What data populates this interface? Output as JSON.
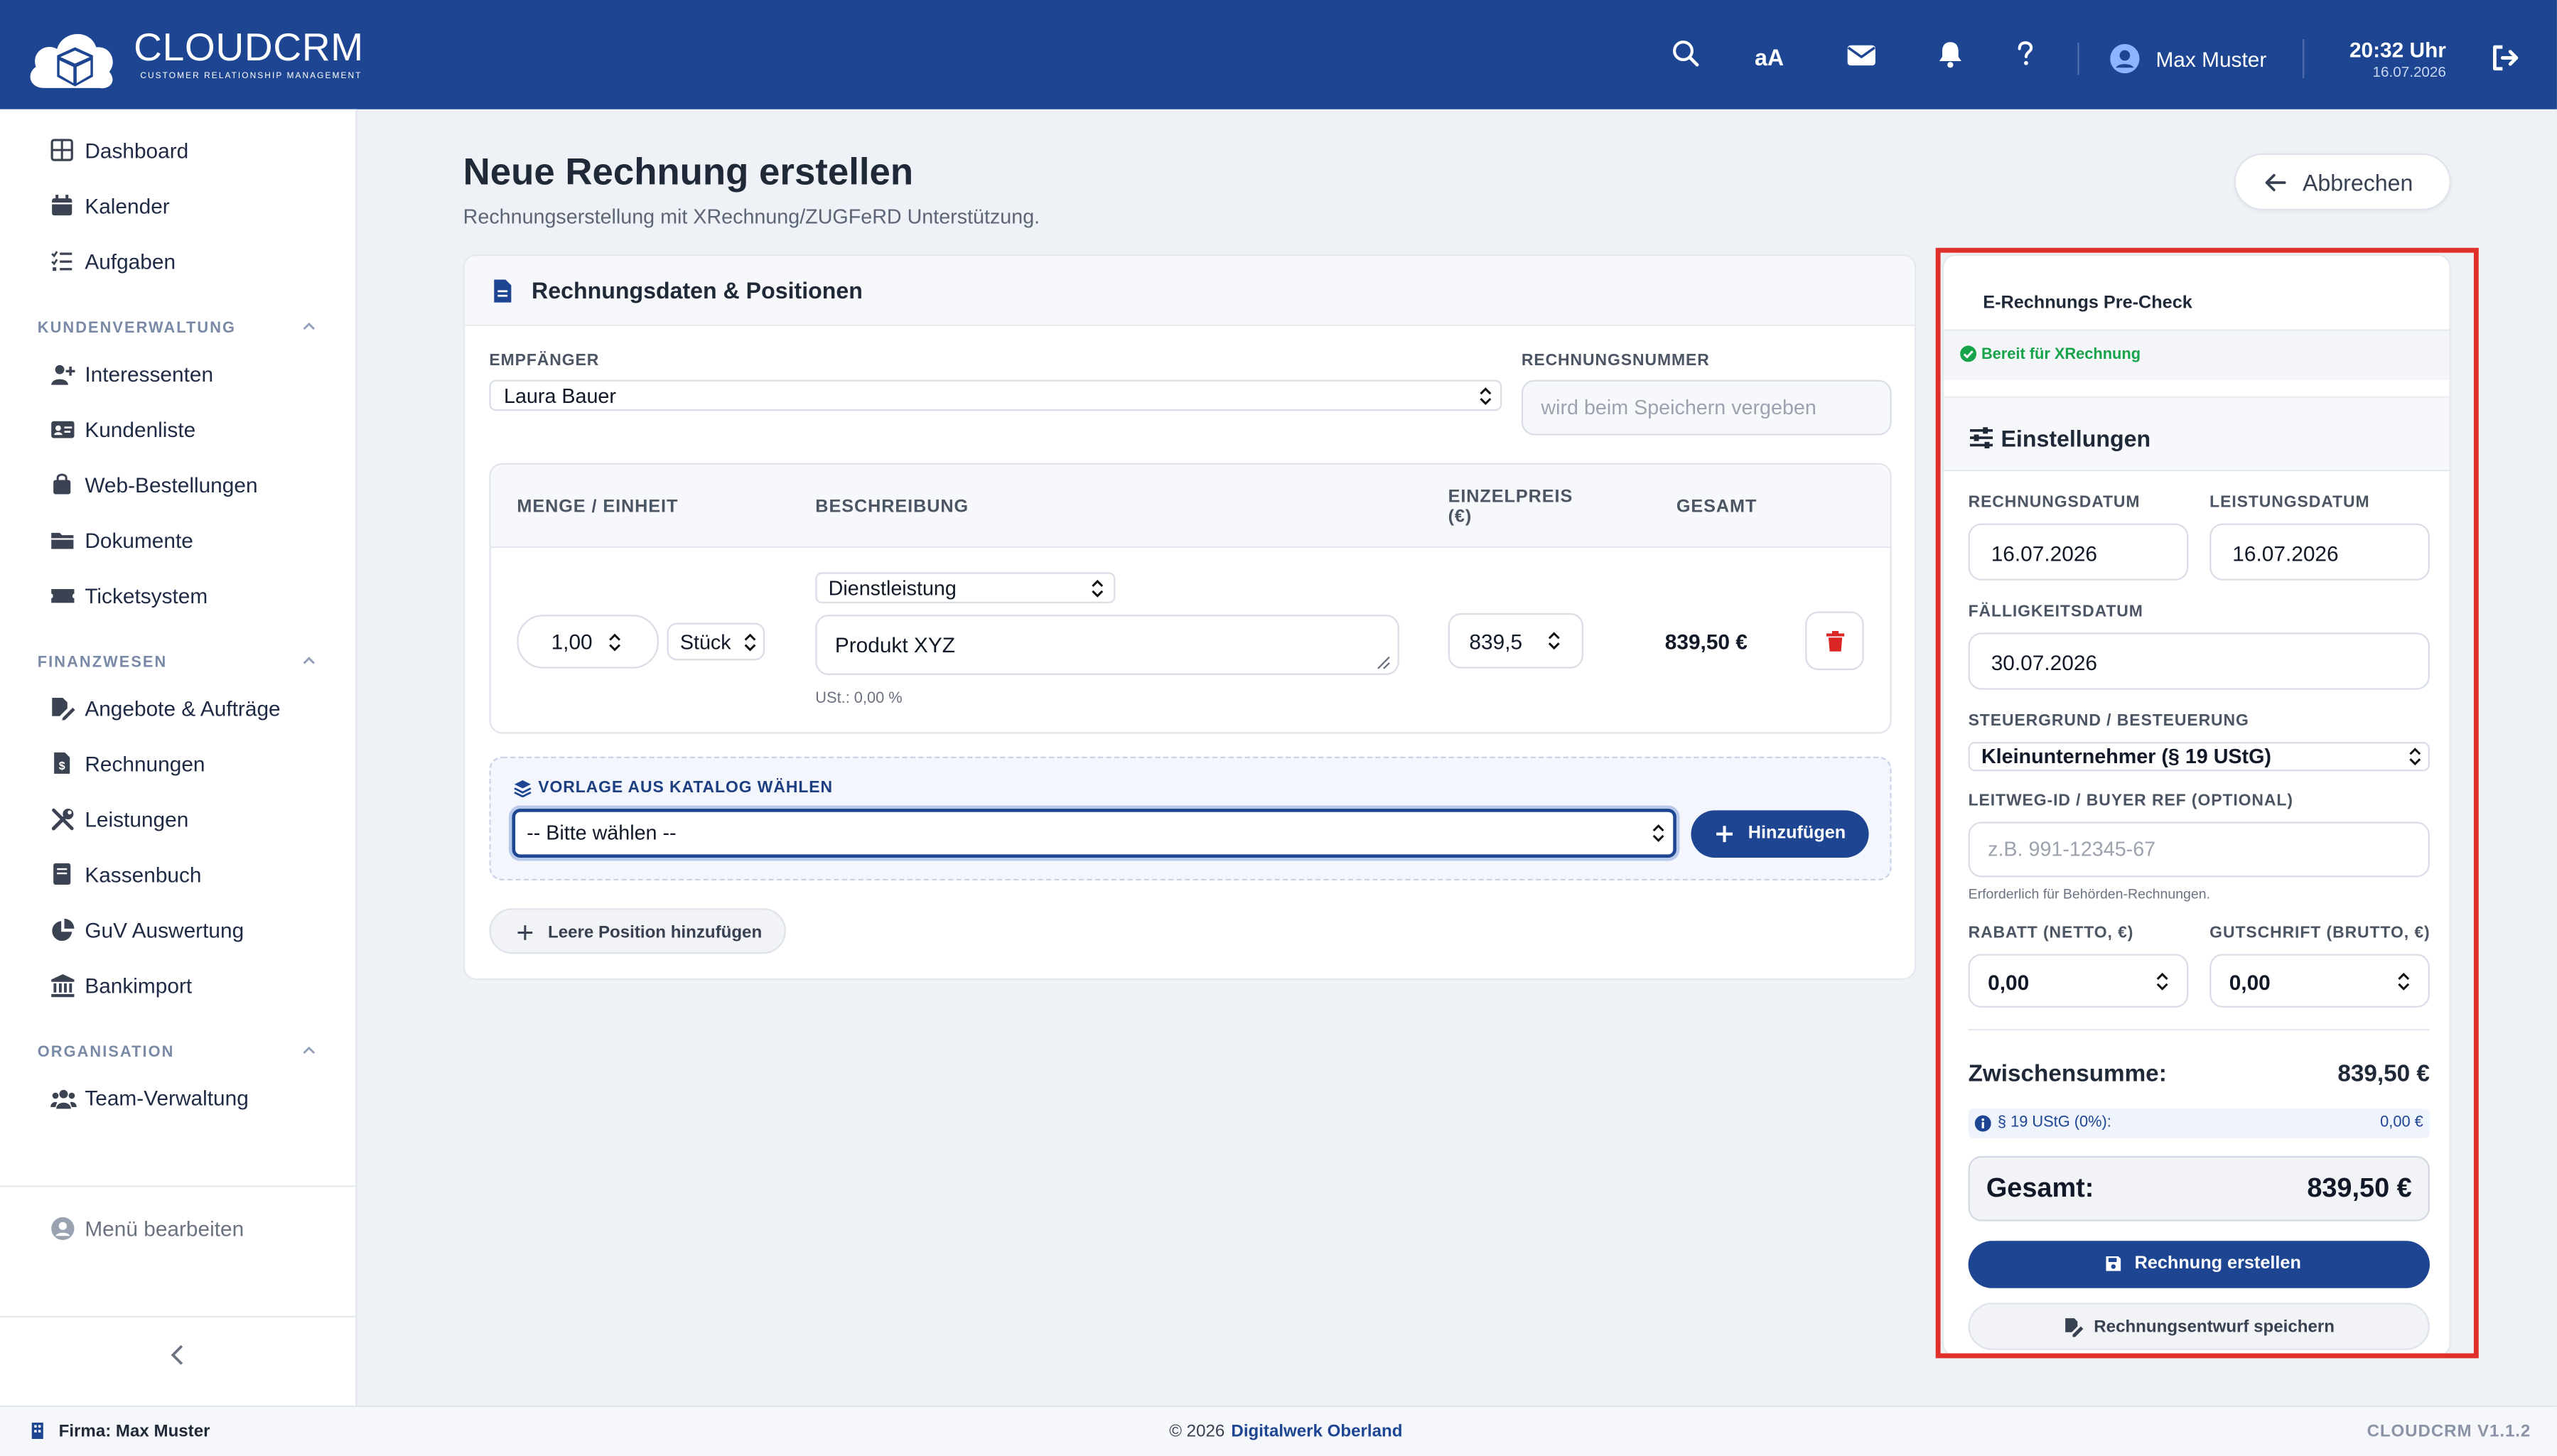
{
  "app": {
    "logo_name": "CLOUDCRM",
    "logo_sub": "CUSTOMER RELATIONSHIP MANAGEMENT",
    "brand_color": "#1d4592"
  },
  "header": {
    "text_size_label": "aA",
    "user_name": "Max Muster",
    "time": "20:32 Uhr",
    "date": "16.07.2026"
  },
  "sidebar": {
    "top_items": [
      {
        "label": "Dashboard",
        "icon": "grid-icon"
      },
      {
        "label": "Kalender",
        "icon": "calendar-icon"
      },
      {
        "label": "Aufgaben",
        "icon": "list-check-icon"
      }
    ],
    "sections": [
      {
        "title": "KUNDENVERWALTUNG",
        "items": [
          {
            "label": "Interessenten",
            "icon": "user-plus-icon"
          },
          {
            "label": "Kundenliste",
            "icon": "id-card-icon"
          },
          {
            "label": "Web-Bestellungen",
            "icon": "shopping-bag-icon"
          },
          {
            "label": "Dokumente",
            "icon": "folder-icon"
          },
          {
            "label": "Ticketsystem",
            "icon": "ticket-icon"
          }
        ]
      },
      {
        "title": "FINANZWESEN",
        "items": [
          {
            "label": "Angebote & Aufträge",
            "icon": "file-signature-icon"
          },
          {
            "label": "Rechnungen",
            "icon": "invoice-icon"
          },
          {
            "label": "Leistungen",
            "icon": "tools-icon"
          },
          {
            "label": "Kassenbuch",
            "icon": "book-icon"
          },
          {
            "label": "GuV Auswertung",
            "icon": "pie-chart-icon"
          },
          {
            "label": "Bankimport",
            "icon": "bank-icon"
          }
        ]
      },
      {
        "title": "ORGANISATION",
        "items": [
          {
            "label": "Team-Verwaltung",
            "icon": "users-icon"
          }
        ]
      }
    ],
    "edit_menu_label": "Menü bearbeiten"
  },
  "page": {
    "title": "Neue Rechnung erstellen",
    "subtitle": "Rechnungserstellung mit XRechnung/ZUGFeRD Unterstützung.",
    "cancel_label": "Abbrechen"
  },
  "invoice": {
    "card_title": "Rechnungsdaten & Positionen",
    "recipient_label": "EMPFÄNGER",
    "recipient_value": "Laura Bauer",
    "number_label": "RECHNUNGSNUMMER",
    "number_placeholder": "wird beim Speichern vergeben",
    "columns": [
      "MENGE / EINHEIT",
      "BESCHREIBUNG",
      "EINZELPREIS (€)",
      "GESAMT"
    ],
    "positions": [
      {
        "quantity": "1,00",
        "unit": "Stück",
        "type": "Dienstleistung",
        "description": "Produkt XYZ",
        "vat_note": "USt.: 0,00 %",
        "unit_price": "839,5",
        "total": "839,50 €"
      }
    ],
    "catalog_label": "VORLAGE AUS KATALOG WÄHLEN",
    "catalog_select": "-- Bitte wählen --",
    "add_label": "Hinzufügen",
    "empty_position_label": "Leere Position hinzufügen"
  },
  "precheck": {
    "title": "E-Rechnungs Pre-Check",
    "status": "Bereit für XRechnung",
    "status_color": "#16a34a"
  },
  "settings": {
    "title": "Einstellungen",
    "invoice_date_label": "RECHNUNGSDATUM",
    "invoice_date": "16.07.2026",
    "service_date_label": "LEISTUNGSDATUM",
    "service_date": "16.07.2026",
    "due_date_label": "FÄLLIGKEITSDATUM",
    "due_date": "30.07.2026",
    "tax_label": "STEUERGRUND / BESTEUERUNG",
    "tax_value": "Kleinunternehmer (§ 19 UStG)",
    "leitweg_label": "LEITWEG-ID / BUYER REF (OPTIONAL)",
    "leitweg_placeholder": "z.B. 991-12345-67",
    "leitweg_hint": "Erforderlich für Behörden-Rechnungen.",
    "discount_label": "RABATT (NETTO, €)",
    "discount_value": "0,00",
    "credit_label": "GUTSCHRIFT (BRUTTO, €)",
    "credit_value": "0,00",
    "subtotal_label": "Zwischensumme:",
    "subtotal_value": "839,50 €",
    "tax_row_label": "§ 19 UStG (0%):",
    "tax_row_value": "0,00 €",
    "total_label": "Gesamt:",
    "total_value": "839,50 €",
    "create_label": "Rechnung erstellen",
    "draft_label": "Rechnungsentwurf speichern"
  },
  "footer": {
    "company": "Firma: Max Muster",
    "copyright_prefix": "© 2026",
    "copyright_link": "Digitalwerk Oberland",
    "version": "CLOUDCRM V1.1.2"
  },
  "highlight_color": "#e0302a"
}
